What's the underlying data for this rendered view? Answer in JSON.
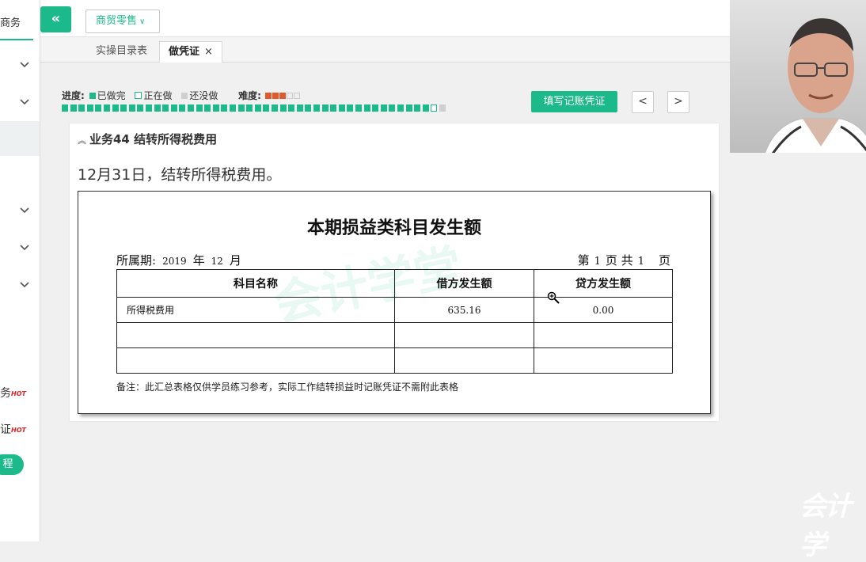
{
  "sidebar": {
    "title": "商务",
    "hot_items": [
      {
        "label": "务",
        "badge": "HOT"
      },
      {
        "label": "证",
        "badge": "HOT"
      }
    ],
    "pill_label": "程"
  },
  "topbar": {
    "collapse_label": "«",
    "business_select": {
      "value": "商贸零售",
      "arrow": "∨"
    }
  },
  "tabs": [
    {
      "label": "实操目录表",
      "active": false
    },
    {
      "label": "做凭证",
      "active": true,
      "close": "×"
    }
  ],
  "progress": {
    "label": "进度:",
    "legend": {
      "done": "已做完",
      "doing": "正在做",
      "todo": "还没做"
    },
    "difficulty_label": "难度:",
    "difficulty": 3,
    "difficulty_max": 5,
    "done_count": 44,
    "doing_index": 44,
    "total": 46
  },
  "actions": {
    "fill_voucher": "填写记账凭证",
    "prev": "<",
    "next": ">"
  },
  "task": {
    "collapse_icon": "»",
    "title": "业务44 结转所得税费用",
    "description": "12月31日，结转所得税费用。"
  },
  "document": {
    "title": "本期损益类科目发生额",
    "period_label": "所属期:",
    "year": "2019",
    "year_unit": "年",
    "month": "12",
    "month_unit": "月",
    "page_prefix": "第",
    "page": "1",
    "page_mid": "页 共",
    "page_total": "1",
    "page_suffix": "页",
    "headers": [
      "科目名称",
      "借方发生额",
      "贷方发生额"
    ],
    "rows": [
      [
        "所得税费用",
        "635.16",
        "0.00"
      ],
      [
        "",
        "",
        ""
      ],
      [
        "",
        "",
        ""
      ]
    ],
    "note": "备注：此汇总表格仅供学员练习参考，实际工作结转损益时记账凭证不需附此表格"
  },
  "watermark": "会计学堂",
  "colors": {
    "accent": "#1cba8a",
    "star": "#e05a2b"
  }
}
